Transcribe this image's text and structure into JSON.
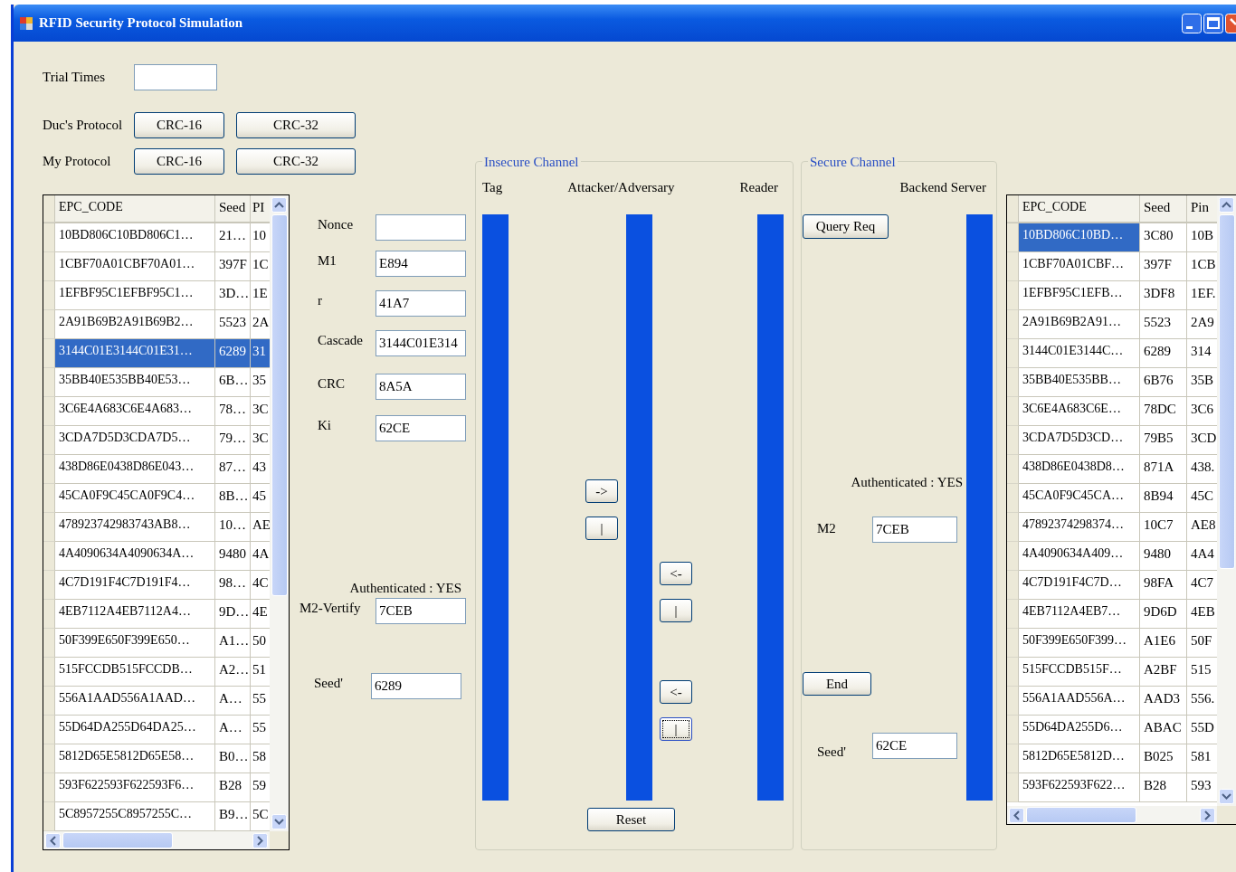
{
  "window": {
    "title": "RFID Security Protocol Simulation"
  },
  "trial_times": {
    "label": "Trial Times"
  },
  "protocols": [
    {
      "label": "Duc's Protocol",
      "buttons": [
        "CRC-16",
        "CRC-32"
      ]
    },
    {
      "label": "My Protocol",
      "buttons": [
        "CRC-16",
        "CRC-32"
      ]
    }
  ],
  "left_table": {
    "full_row_select": true,
    "columns": [
      "EPC_CODE",
      "Seed",
      "PI"
    ],
    "rows": [
      {
        "cells": [
          "10BD806C10BD806C1…",
          "21…",
          "10"
        ],
        "selected": false
      },
      {
        "cells": [
          "1CBF70A01CBF70A01…",
          "397F",
          "1C"
        ],
        "selected": false
      },
      {
        "cells": [
          "1EFBF95C1EFBF95C1…",
          "3D…",
          "1E"
        ],
        "selected": false
      },
      {
        "cells": [
          "2A91B69B2A91B69B2…",
          "5523",
          "2A"
        ],
        "selected": false
      },
      {
        "cells": [
          "3144C01E3144C01E31…",
          "6289",
          "31"
        ],
        "selected": true
      },
      {
        "cells": [
          "35BB40E535BB40E53…",
          "6B…",
          "35"
        ],
        "selected": false
      },
      {
        "cells": [
          "3C6E4A683C6E4A683…",
          "78…",
          "3C"
        ],
        "selected": false
      },
      {
        "cells": [
          "3CDA7D5D3CDA7D5…",
          "79…",
          "3C"
        ],
        "selected": false
      },
      {
        "cells": [
          "438D86E0438D86E043…",
          "87…",
          "43"
        ],
        "selected": false
      },
      {
        "cells": [
          "45CA0F9C45CA0F9C4…",
          "8B…",
          "45"
        ],
        "selected": false
      },
      {
        "cells": [
          "478923742983743AB8…",
          "10…",
          "AE"
        ],
        "selected": false
      },
      {
        "cells": [
          "4A4090634A4090634A…",
          "9480",
          "4A"
        ],
        "selected": false
      },
      {
        "cells": [
          "4C7D191F4C7D191F4…",
          "98…",
          "4C"
        ],
        "selected": false
      },
      {
        "cells": [
          "4EB7112A4EB7112A4…",
          "9D…",
          "4E"
        ],
        "selected": false
      },
      {
        "cells": [
          "50F399E650F399E650…",
          "A1…",
          "50"
        ],
        "selected": false
      },
      {
        "cells": [
          "515FCCDB515FCCDB…",
          "A2…",
          "51"
        ],
        "selected": false
      },
      {
        "cells": [
          "556A1AAD556A1AAD…",
          "A…",
          "55"
        ],
        "selected": false
      },
      {
        "cells": [
          "55D64DA255D64DA25…",
          "A…",
          "55"
        ],
        "selected": false
      },
      {
        "cells": [
          "5812D65E5812D65E58…",
          "B0…",
          "58"
        ],
        "selected": false
      },
      {
        "cells": [
          "593F622593F622593F6…",
          "B28",
          "59"
        ],
        "selected": false
      },
      {
        "cells": [
          "5C8957255C8957255C…",
          "B9…",
          "5C"
        ],
        "selected": false
      }
    ]
  },
  "tag_fields": [
    {
      "label": "Nonce"
    },
    {
      "label": "M1",
      "value": "E894"
    },
    {
      "label": "r",
      "value": "41A7"
    },
    {
      "label": "Cascade",
      "value": "3144C01E314"
    },
    {
      "label": "CRC",
      "value": "8A5A"
    },
    {
      "label": "Ki",
      "value": "62CE"
    }
  ],
  "tag_status": "Authenticated : YES",
  "verify_fields": [
    {
      "label": "M2-Vertify",
      "value": "7CEB"
    },
    {
      "label": "Seed'",
      "value": "6289"
    }
  ],
  "insecure_channel": {
    "title": "Insecure Channel",
    "lanes": [
      "Tag",
      "Attacker/Adversary",
      "Reader"
    ],
    "tag_buttons": [
      {
        "label": "->",
        "focused": false
      },
      {
        "label": "|",
        "focused": false
      }
    ],
    "reader_buttons": [
      {
        "label": "<-",
        "focused": false
      },
      {
        "label": "|",
        "focused": false
      },
      {
        "label": "<-",
        "focused": false
      },
      {
        "label": "|",
        "focused": true
      }
    ],
    "reset_button": "Reset"
  },
  "secure_channel": {
    "title": "Secure Channel",
    "lane": "Backend Server",
    "query_button": "Query Req",
    "status": "Authenticated : YES",
    "fields": [
      {
        "label": "M2",
        "value": "7CEB"
      },
      {
        "label": "Seed'",
        "value": "62CE"
      }
    ],
    "end_button": "End"
  },
  "right_table": {
    "full_row_select": false,
    "columns": [
      "EPC_CODE",
      "Seed",
      "Pin"
    ],
    "rows": [
      {
        "cells": [
          "10BD806C10BD…",
          "3C80",
          "10B"
        ],
        "selected": true
      },
      {
        "cells": [
          "1CBF70A01CBF…",
          "397F",
          "1CB"
        ],
        "selected": false
      },
      {
        "cells": [
          "1EFBF95C1EFB…",
          "3DF8",
          "1EF."
        ],
        "selected": false
      },
      {
        "cells": [
          "2A91B69B2A91…",
          "5523",
          "2A9"
        ],
        "selected": false
      },
      {
        "cells": [
          "3144C01E3144C…",
          "6289",
          "314"
        ],
        "selected": false
      },
      {
        "cells": [
          "35BB40E535BB…",
          "6B76",
          "35B"
        ],
        "selected": false
      },
      {
        "cells": [
          "3C6E4A683C6E…",
          "78DC",
          "3C6"
        ],
        "selected": false
      },
      {
        "cells": [
          "3CDA7D5D3CD…",
          "79B5",
          "3CD"
        ],
        "selected": false
      },
      {
        "cells": [
          "438D86E0438D8…",
          "871A",
          "438."
        ],
        "selected": false
      },
      {
        "cells": [
          "45CA0F9C45CA…",
          "8B94",
          "45C"
        ],
        "selected": false
      },
      {
        "cells": [
          "47892374298374…",
          "10C7",
          "AE8"
        ],
        "selected": false
      },
      {
        "cells": [
          "4A4090634A409…",
          "9480",
          "4A4"
        ],
        "selected": false
      },
      {
        "cells": [
          "4C7D191F4C7D…",
          "98FA",
          "4C7"
        ],
        "selected": false
      },
      {
        "cells": [
          "4EB7112A4EB7…",
          "9D6D",
          "4EB"
        ],
        "selected": false
      },
      {
        "cells": [
          "50F399E650F399…",
          "A1E6",
          "50F"
        ],
        "selected": false
      },
      {
        "cells": [
          "515FCCDB515F…",
          "A2BF",
          "515"
        ],
        "selected": false
      },
      {
        "cells": [
          "556A1AAD556A…",
          "AAD3",
          "556."
        ],
        "selected": false
      },
      {
        "cells": [
          "55D64DA255D6…",
          "ABAC",
          "55D"
        ],
        "selected": false
      },
      {
        "cells": [
          "5812D65E5812D…",
          "B025",
          "581"
        ],
        "selected": false
      },
      {
        "cells": [
          "593F622593F622…",
          "B28",
          "593"
        ],
        "selected": false
      }
    ]
  }
}
